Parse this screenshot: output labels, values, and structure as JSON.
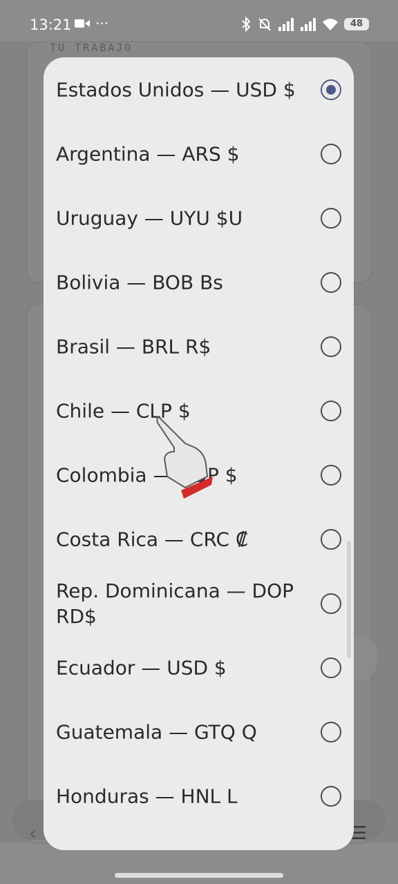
{
  "status_bar": {
    "time": "13:21",
    "battery": "48"
  },
  "background": {
    "section_label": "TU TRABAJO"
  },
  "dialog": {
    "options": [
      {
        "label": "Estados Unidos — USD $",
        "selected": true
      },
      {
        "label": "Argentina — ARS $",
        "selected": false
      },
      {
        "label": "Uruguay — UYU $U",
        "selected": false
      },
      {
        "label": "Bolivia — BOB Bs",
        "selected": false
      },
      {
        "label": "Brasil — BRL R$",
        "selected": false
      },
      {
        "label": "Chile — CLP $",
        "selected": false
      },
      {
        "label": "Colombia — COP $",
        "selected": false
      },
      {
        "label": "Costa Rica — CRC ₡",
        "selected": false
      },
      {
        "label": "Rep. Dominicana — DOP RD$",
        "selected": false
      },
      {
        "label": "Ecuador — USD $",
        "selected": false
      },
      {
        "label": "Guatemala — GTQ Q",
        "selected": false
      },
      {
        "label": "Honduras — HNL L",
        "selected": false
      }
    ]
  },
  "colors": {
    "accent": "#4f5b86",
    "dialog_bg": "#ebebeb",
    "scrim": "#858381"
  }
}
